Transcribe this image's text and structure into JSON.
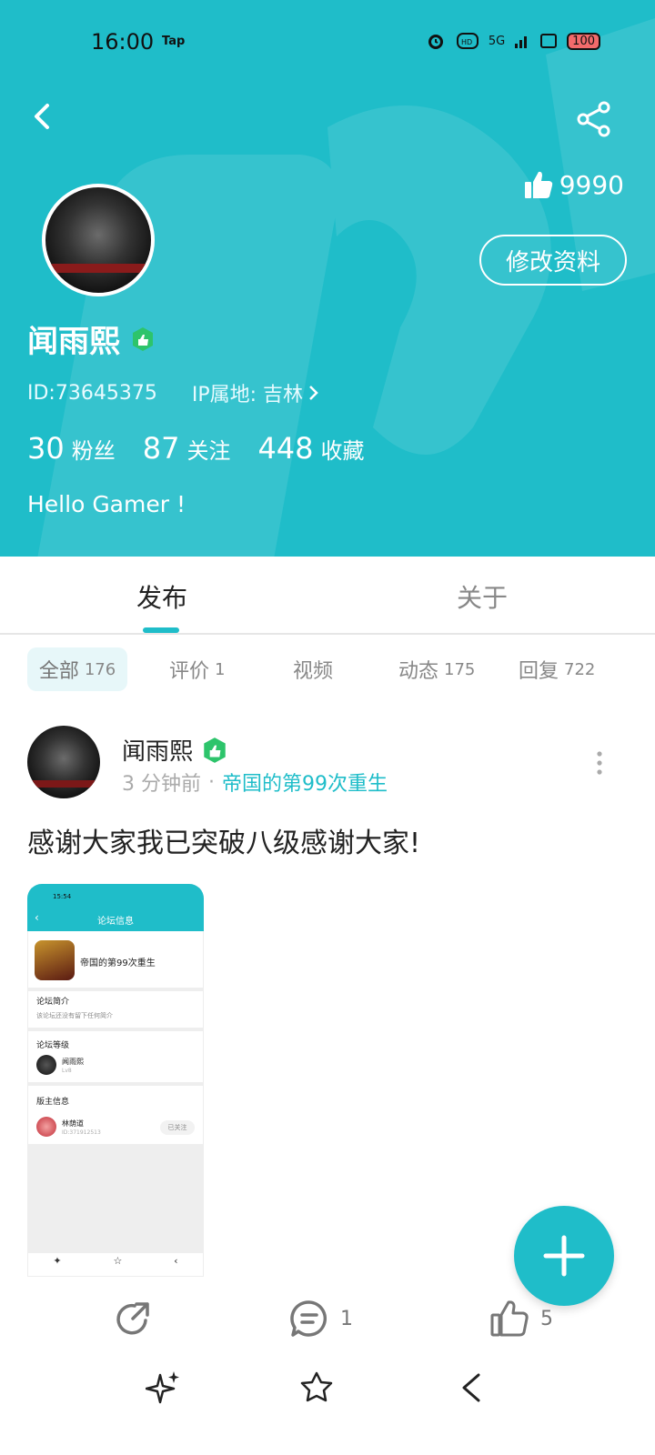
{
  "status_bar": {
    "time": "16:00",
    "tap_label": "Tap",
    "network": "5G",
    "battery": "100"
  },
  "profile": {
    "likes": "9990",
    "edit_button": "修改资料",
    "username": "闻雨熙",
    "id_text": "ID:73645375",
    "ip_text": "IP属地: 吉林",
    "stats": [
      {
        "num": "30",
        "label": "粉丝"
      },
      {
        "num": "87",
        "label": "关注"
      },
      {
        "num": "448",
        "label": "收藏"
      }
    ],
    "bio": "Hello Gamer !"
  },
  "tabs": {
    "post": "发布",
    "about": "关于"
  },
  "filters": [
    {
      "label": "全部",
      "count": "176"
    },
    {
      "label": "评价",
      "count": "1"
    },
    {
      "label": "视频",
      "count": ""
    },
    {
      "label": "动态",
      "count": "175"
    },
    {
      "label": "回复",
      "count": "722"
    }
  ],
  "post": {
    "author": "闻雨熙",
    "time": "3 分钟前",
    "separator": "·",
    "forum": "帝国的第99次重生",
    "text": "感谢大家我已突破八级感谢大家!",
    "comments": "1",
    "likes": "5",
    "thumbnail": {
      "time": "15:54",
      "title": "论坛信息",
      "game_name": "帝国的第99次重生",
      "intro_title": "论坛简介",
      "intro_text": "该论坛还没有留下任何简介",
      "level_title": "论坛等级",
      "level_user": "闻雨熙",
      "level_value": "Lv8",
      "admin_title": "版主信息",
      "admin_name": "林荫道",
      "admin_id": "ID:371912513",
      "follow_label": "已关注"
    }
  },
  "colors": {
    "accent": "#1fbdc9"
  }
}
